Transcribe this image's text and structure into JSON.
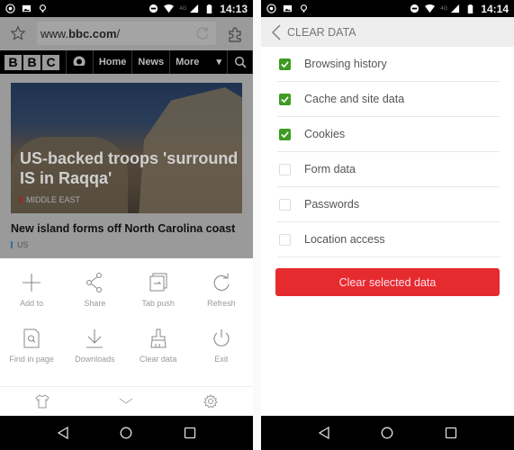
{
  "left_screen": {
    "status_bar": {
      "time": "14:13",
      "network": "4G",
      "left_icons": [
        "whatsapp-icon",
        "image-icon",
        "bulb-icon"
      ],
      "right_icons": [
        "dnd-icon",
        "wifi-icon",
        "signal-icon",
        "battery-icon"
      ]
    },
    "url_bar": {
      "url_prefix": "www.",
      "url_domain": "bbc.com",
      "url_suffix": "/"
    },
    "bbc_nav": {
      "logo_letters": [
        "B",
        "B",
        "C"
      ],
      "items": [
        "Home",
        "News",
        "More"
      ],
      "more_caret": "⌄"
    },
    "articles": {
      "hero": {
        "title": "US-backed troops 'surround IS in Raqqa'",
        "tag": "MIDDLE EAST"
      },
      "second": {
        "title": "New island forms off North Carolina coast",
        "tag": "US"
      }
    },
    "menu": {
      "items": [
        {
          "label": "Add to",
          "icon": "plus-icon"
        },
        {
          "label": "Share",
          "icon": "share-icon"
        },
        {
          "label": "Tab push",
          "icon": "tab-push-icon"
        },
        {
          "label": "Refresh",
          "icon": "refresh-icon"
        },
        {
          "label": "Find in page",
          "icon": "find-in-page-icon"
        },
        {
          "label": "Downloads",
          "icon": "download-icon"
        },
        {
          "label": "Clear data",
          "icon": "broom-icon"
        },
        {
          "label": "Exit",
          "icon": "power-icon"
        }
      ],
      "bottom": [
        "shirt-icon",
        "chevron-down-icon",
        "gear-icon"
      ]
    }
  },
  "right_screen": {
    "status_bar": {
      "time": "14:14",
      "network": "4G"
    },
    "header": {
      "title": "CLEAR DATA"
    },
    "options": [
      {
        "label": "Browsing history",
        "checked": true
      },
      {
        "label": "Cache and site data",
        "checked": true
      },
      {
        "label": "Cookies",
        "checked": true
      },
      {
        "label": "Form data",
        "checked": false
      },
      {
        "label": "Passwords",
        "checked": false
      },
      {
        "label": "Location access",
        "checked": false
      }
    ],
    "button_label": "Clear selected data"
  },
  "colors": {
    "check_green": "#3d9b22",
    "button_red": "#e52b2e"
  }
}
